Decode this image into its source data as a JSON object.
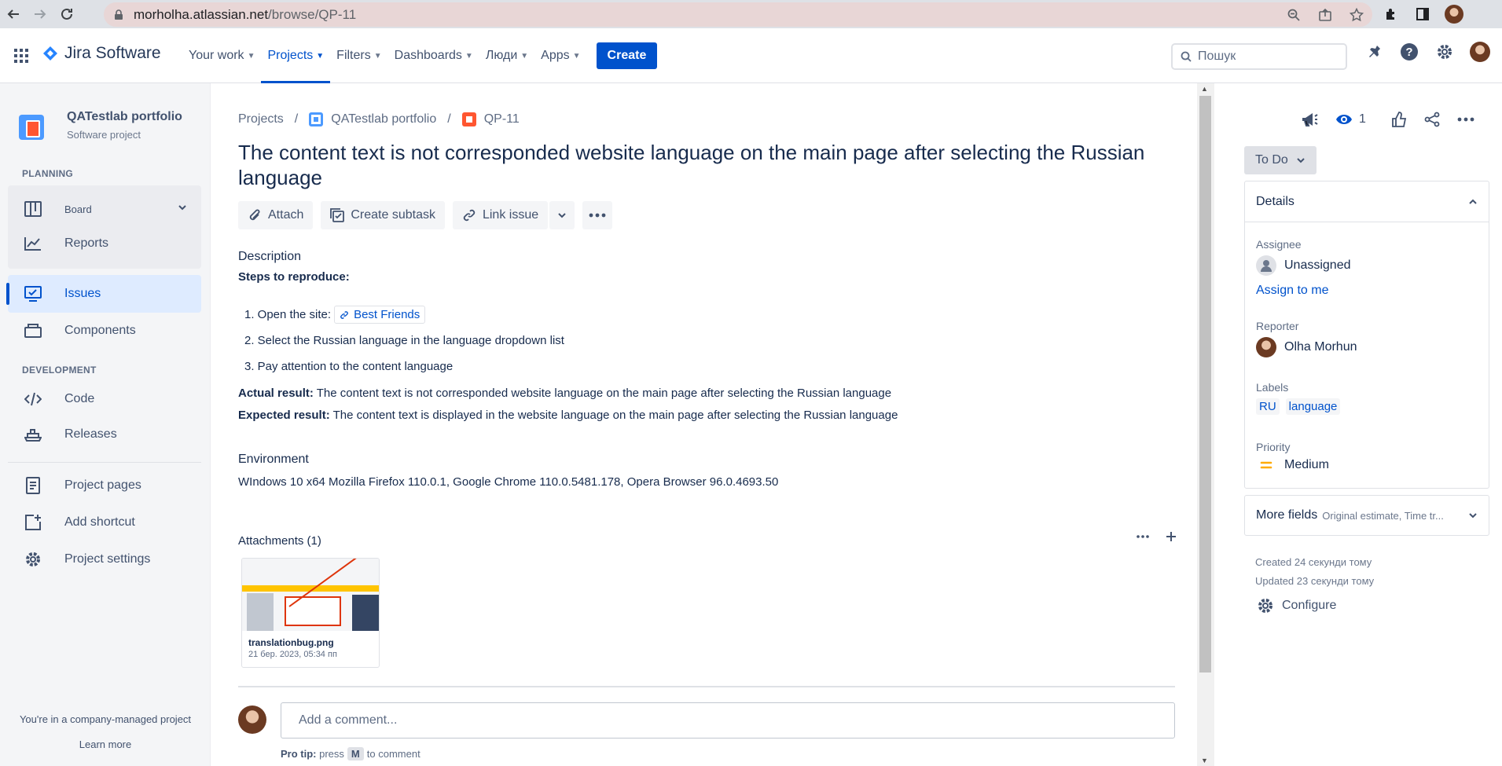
{
  "browser": {
    "url_host": "morholha.atlassian.net",
    "url_path": "/browse/QP-11"
  },
  "topnav": {
    "product": "Jira Software",
    "menu": [
      {
        "label": "Your work",
        "active": false
      },
      {
        "label": "Projects",
        "active": true
      },
      {
        "label": "Filters",
        "active": false
      },
      {
        "label": "Dashboards",
        "active": false
      },
      {
        "label": "Люди",
        "active": false
      },
      {
        "label": "Apps",
        "active": false
      }
    ],
    "create_label": "Create",
    "search_placeholder": "Пошук"
  },
  "sidebar": {
    "project_name": "QATestlab portfolio",
    "project_type": "Software project",
    "planning_header": "PLANNING",
    "board": "Board",
    "reports": "Reports",
    "issues": "Issues",
    "components": "Components",
    "development_header": "DEVELOPMENT",
    "code": "Code",
    "releases": "Releases",
    "project_pages": "Project pages",
    "add_shortcut": "Add shortcut",
    "project_settings": "Project settings",
    "footer_text": "You're in a company-managed project",
    "learn_more": "Learn more"
  },
  "issue": {
    "breadcrumb": {
      "projects": "Projects",
      "project": "QATestlab portfolio",
      "key": "QP-11"
    },
    "title": "The content text is not corresponded website language on the main page after selecting the Russian language",
    "actions": {
      "attach": "Attach",
      "create_subtask": "Create subtask",
      "link_issue": "Link issue"
    },
    "description_label": "Description",
    "steps_title": "Steps to reproduce:",
    "step1": "1. Open the site:",
    "step1_link": "Best Friends",
    "step2": "2. Select the Russian language in the language dropdown list",
    "step3": "3. Pay attention to the content language",
    "actual_label": "Actual result:",
    "actual_text": " The content text is not corresponded website language on the main page after selecting the Russian language",
    "expected_label": "Expected result:",
    "expected_text": " The content text is displayed in the website language on the main page after selecting the Russian language",
    "environment_label": "Environment",
    "environment_text": "WIndows 10 x64 Mozilla Firefox 110.0.1, Google Chrome 110.0.5481.178, Opera Browser 96.0.4693.50",
    "attachments_label": "Attachments (1)",
    "attachment": {
      "filename": "translationbug.png",
      "date": "21 бер. 2023, 05:34 пп"
    },
    "comment_placeholder": "Add a comment...",
    "pro_tip_label": "Pro tip:",
    "pro_tip_press": "press",
    "pro_tip_key": "M",
    "pro_tip_rest": "to comment"
  },
  "right": {
    "watchers": "1",
    "status": "To Do",
    "details_label": "Details",
    "assignee_label": "Assignee",
    "assignee_value": "Unassigned",
    "assign_to_me": "Assign to me",
    "reporter_label": "Reporter",
    "reporter_value": "Olha Morhun",
    "labels_label": "Labels",
    "labels": [
      "RU",
      "language"
    ],
    "priority_label": "Priority",
    "priority_value": "Medium",
    "more_fields": "More fields",
    "more_fields_hint": "Original estimate, Time tr...",
    "created": "Created 24 секунди тому",
    "updated": "Updated 23 секунди тому",
    "configure": "Configure"
  },
  "colors": {
    "accent": "#0052cc",
    "sidebar_bg": "#f4f5f7",
    "priority_medium": "#ffab00",
    "issue_type": "#ff5630"
  }
}
